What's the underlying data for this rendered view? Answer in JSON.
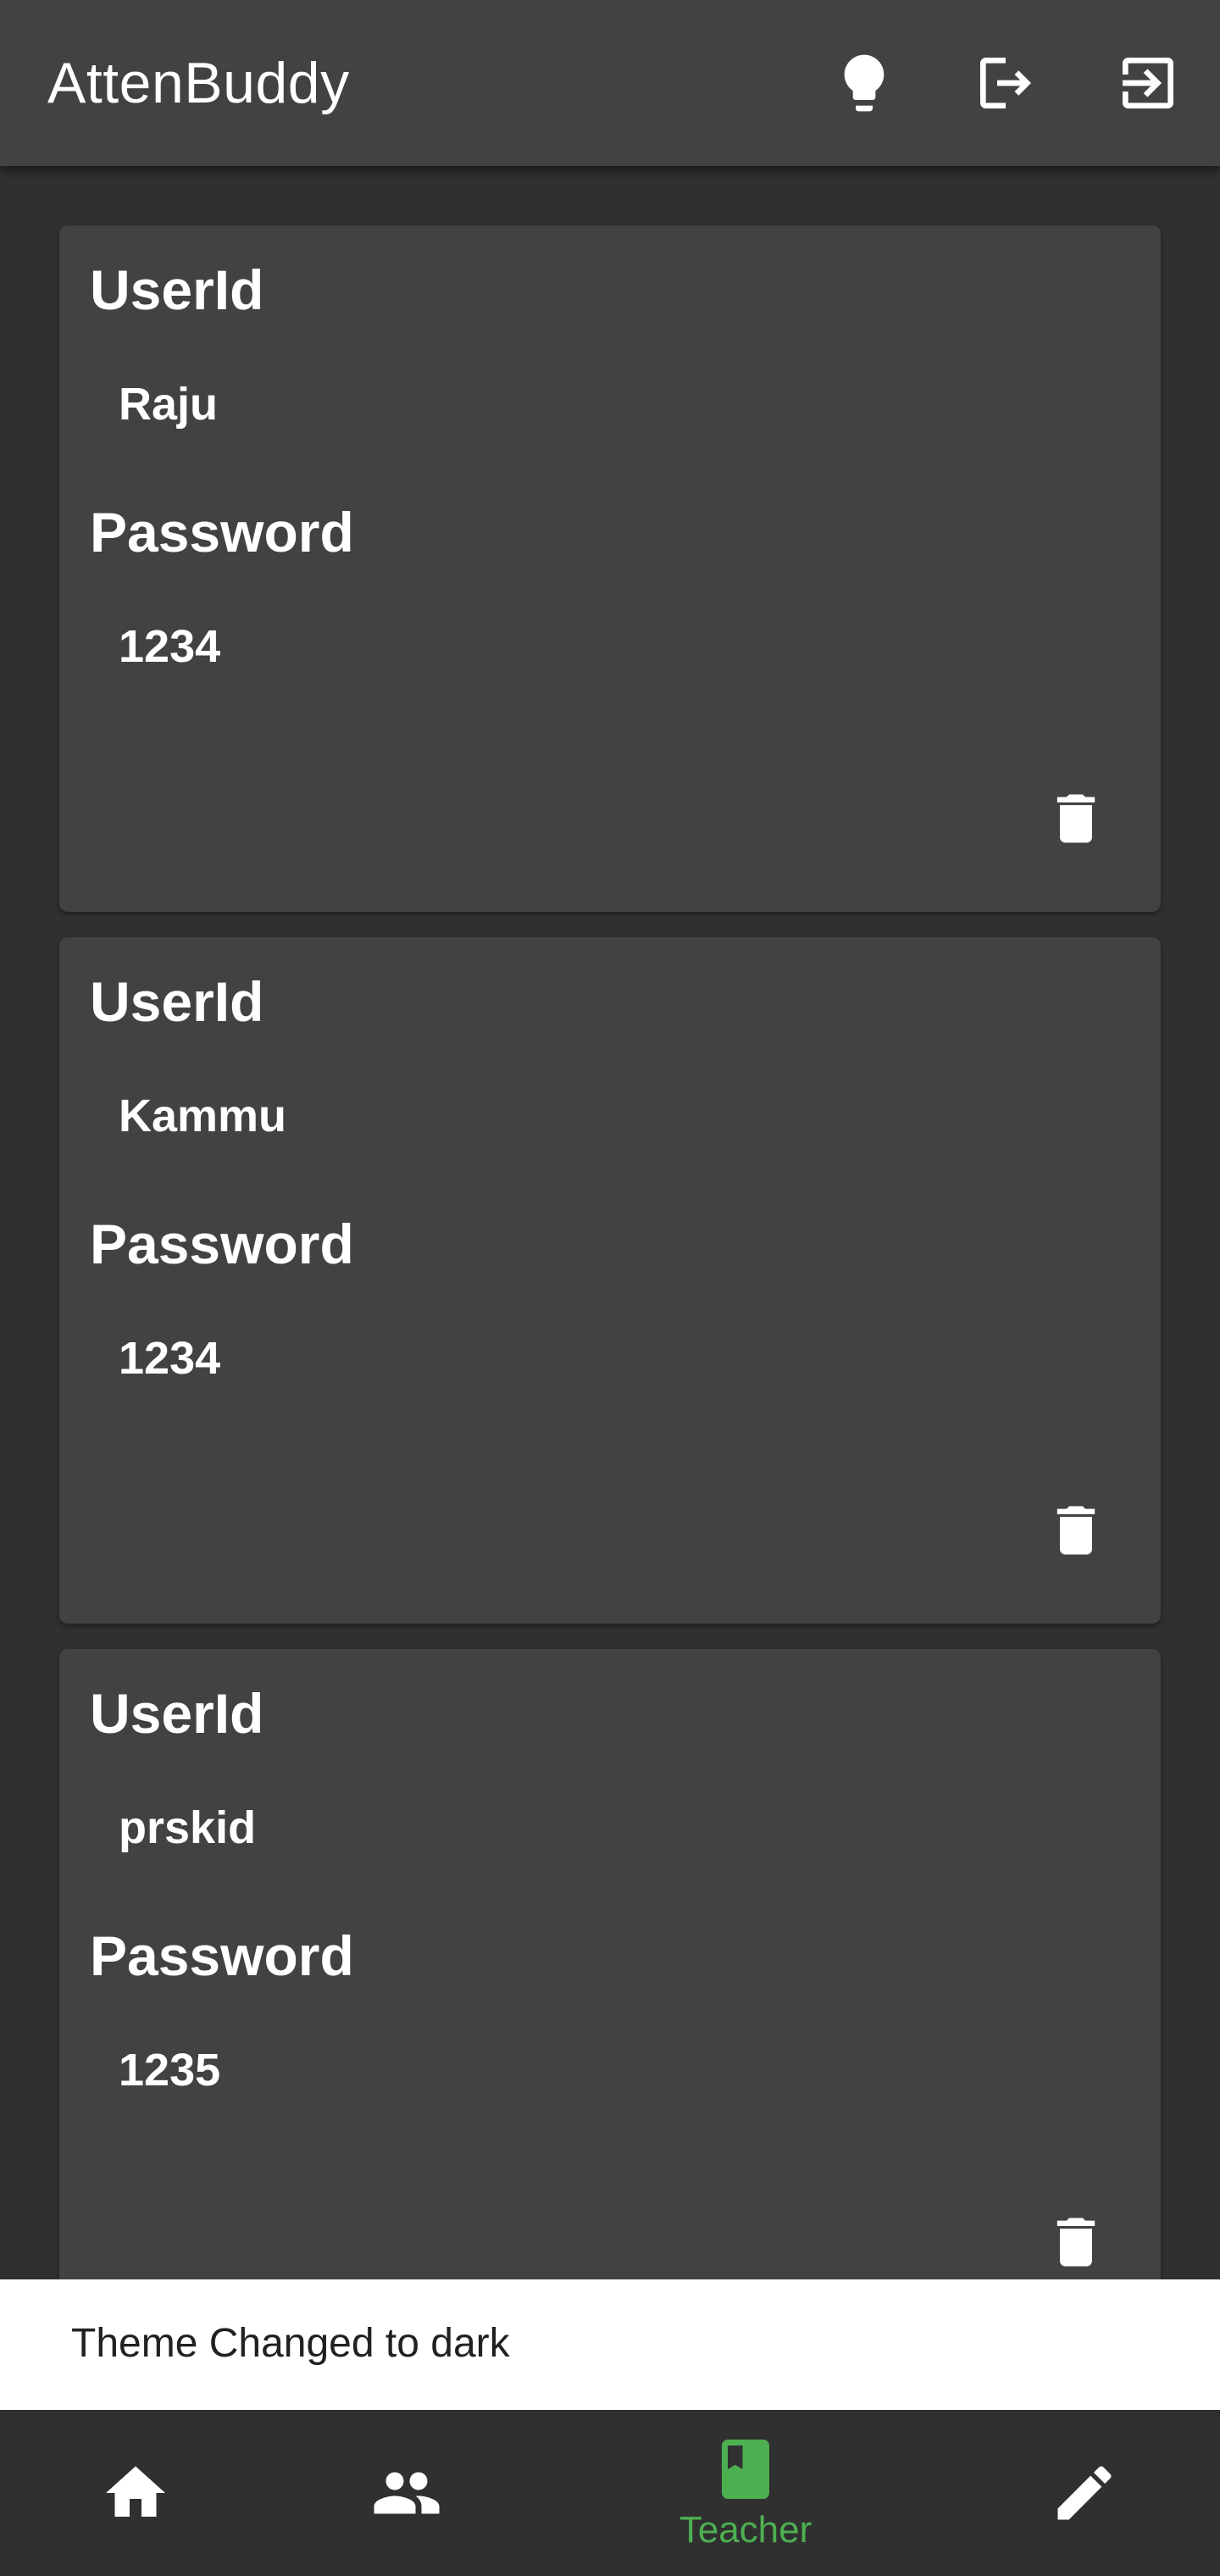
{
  "app": {
    "title": "AttenBuddy",
    "actions": [
      {
        "icon": "lightbulb-icon"
      },
      {
        "icon": "logout-icon"
      },
      {
        "icon": "login-icon"
      }
    ]
  },
  "cards": [
    {
      "userid_label": "UserId",
      "userid": "Raju",
      "password_label": "Password",
      "password": "1234",
      "delete_icon": "trash-icon"
    },
    {
      "userid_label": "UserId",
      "userid": "Kammu",
      "password_label": "Password",
      "password": "1234",
      "delete_icon": "trash-icon"
    },
    {
      "userid_label": "UserId",
      "userid": "prskid",
      "password_label": "Password",
      "password": "1235",
      "delete_icon": "trash-icon"
    }
  ],
  "snackbar": {
    "message": "Theme Changed to dark"
  },
  "bottom_nav": {
    "items": [
      {
        "icon": "home-icon",
        "label": ""
      },
      {
        "icon": "people-icon",
        "label": ""
      },
      {
        "icon": "book-icon",
        "label": "Teacher",
        "active": true
      },
      {
        "icon": "pencil-icon",
        "label": ""
      }
    ],
    "active_color": "#4caf50"
  },
  "colors": {
    "background": "#303030",
    "surface": "#424242",
    "accent": "#4caf50"
  }
}
